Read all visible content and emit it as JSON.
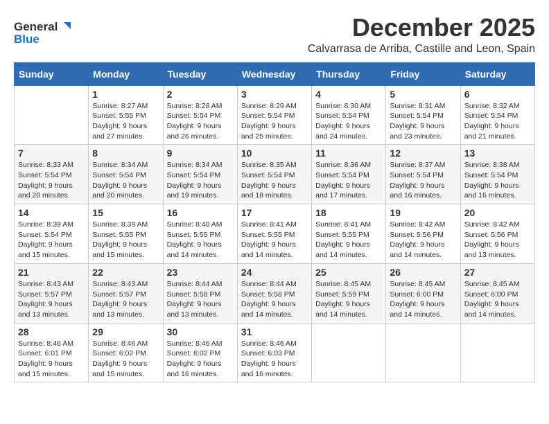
{
  "header": {
    "logo_line1": "General",
    "logo_line2": "Blue",
    "month_title": "December 2025",
    "subtitle": "Calvarrasa de Arriba, Castille and Leon, Spain"
  },
  "days_of_week": [
    "Sunday",
    "Monday",
    "Tuesday",
    "Wednesday",
    "Thursday",
    "Friday",
    "Saturday"
  ],
  "weeks": [
    [
      {
        "day": "",
        "info": ""
      },
      {
        "day": "1",
        "info": "Sunrise: 8:27 AM\nSunset: 5:55 PM\nDaylight: 9 hours\nand 27 minutes."
      },
      {
        "day": "2",
        "info": "Sunrise: 8:28 AM\nSunset: 5:54 PM\nDaylight: 9 hours\nand 26 minutes."
      },
      {
        "day": "3",
        "info": "Sunrise: 8:29 AM\nSunset: 5:54 PM\nDaylight: 9 hours\nand 25 minutes."
      },
      {
        "day": "4",
        "info": "Sunrise: 8:30 AM\nSunset: 5:54 PM\nDaylight: 9 hours\nand 24 minutes."
      },
      {
        "day": "5",
        "info": "Sunrise: 8:31 AM\nSunset: 5:54 PM\nDaylight: 9 hours\nand 23 minutes."
      },
      {
        "day": "6",
        "info": "Sunrise: 8:32 AM\nSunset: 5:54 PM\nDaylight: 9 hours\nand 21 minutes."
      }
    ],
    [
      {
        "day": "7",
        "info": "Sunrise: 8:33 AM\nSunset: 5:54 PM\nDaylight: 9 hours\nand 20 minutes."
      },
      {
        "day": "8",
        "info": "Sunrise: 8:34 AM\nSunset: 5:54 PM\nDaylight: 9 hours\nand 20 minutes."
      },
      {
        "day": "9",
        "info": "Sunrise: 8:34 AM\nSunset: 5:54 PM\nDaylight: 9 hours\nand 19 minutes."
      },
      {
        "day": "10",
        "info": "Sunrise: 8:35 AM\nSunset: 5:54 PM\nDaylight: 9 hours\nand 18 minutes."
      },
      {
        "day": "11",
        "info": "Sunrise: 8:36 AM\nSunset: 5:54 PM\nDaylight: 9 hours\nand 17 minutes."
      },
      {
        "day": "12",
        "info": "Sunrise: 8:37 AM\nSunset: 5:54 PM\nDaylight: 9 hours\nand 16 minutes."
      },
      {
        "day": "13",
        "info": "Sunrise: 8:38 AM\nSunset: 5:54 PM\nDaylight: 9 hours\nand 16 minutes."
      }
    ],
    [
      {
        "day": "14",
        "info": "Sunrise: 8:39 AM\nSunset: 5:54 PM\nDaylight: 9 hours\nand 15 minutes."
      },
      {
        "day": "15",
        "info": "Sunrise: 8:39 AM\nSunset: 5:55 PM\nDaylight: 9 hours\nand 15 minutes."
      },
      {
        "day": "16",
        "info": "Sunrise: 8:40 AM\nSunset: 5:55 PM\nDaylight: 9 hours\nand 14 minutes."
      },
      {
        "day": "17",
        "info": "Sunrise: 8:41 AM\nSunset: 5:55 PM\nDaylight: 9 hours\nand 14 minutes."
      },
      {
        "day": "18",
        "info": "Sunrise: 8:41 AM\nSunset: 5:55 PM\nDaylight: 9 hours\nand 14 minutes."
      },
      {
        "day": "19",
        "info": "Sunrise: 8:42 AM\nSunset: 5:56 PM\nDaylight: 9 hours\nand 14 minutes."
      },
      {
        "day": "20",
        "info": "Sunrise: 8:42 AM\nSunset: 5:56 PM\nDaylight: 9 hours\nand 13 minutes."
      }
    ],
    [
      {
        "day": "21",
        "info": "Sunrise: 8:43 AM\nSunset: 5:57 PM\nDaylight: 9 hours\nand 13 minutes."
      },
      {
        "day": "22",
        "info": "Sunrise: 8:43 AM\nSunset: 5:57 PM\nDaylight: 9 hours\nand 13 minutes."
      },
      {
        "day": "23",
        "info": "Sunrise: 8:44 AM\nSunset: 5:58 PM\nDaylight: 9 hours\nand 13 minutes."
      },
      {
        "day": "24",
        "info": "Sunrise: 8:44 AM\nSunset: 5:58 PM\nDaylight: 9 hours\nand 14 minutes."
      },
      {
        "day": "25",
        "info": "Sunrise: 8:45 AM\nSunset: 5:59 PM\nDaylight: 9 hours\nand 14 minutes."
      },
      {
        "day": "26",
        "info": "Sunrise: 8:45 AM\nSunset: 6:00 PM\nDaylight: 9 hours\nand 14 minutes."
      },
      {
        "day": "27",
        "info": "Sunrise: 8:45 AM\nSunset: 6:00 PM\nDaylight: 9 hours\nand 14 minutes."
      }
    ],
    [
      {
        "day": "28",
        "info": "Sunrise: 8:46 AM\nSunset: 6:01 PM\nDaylight: 9 hours\nand 15 minutes."
      },
      {
        "day": "29",
        "info": "Sunrise: 8:46 AM\nSunset: 6:02 PM\nDaylight: 9 hours\nand 15 minutes."
      },
      {
        "day": "30",
        "info": "Sunrise: 8:46 AM\nSunset: 6:02 PM\nDaylight: 9 hours\nand 16 minutes."
      },
      {
        "day": "31",
        "info": "Sunrise: 8:46 AM\nSunset: 6:03 PM\nDaylight: 9 hours\nand 16 minutes."
      },
      {
        "day": "",
        "info": ""
      },
      {
        "day": "",
        "info": ""
      },
      {
        "day": "",
        "info": ""
      }
    ]
  ]
}
